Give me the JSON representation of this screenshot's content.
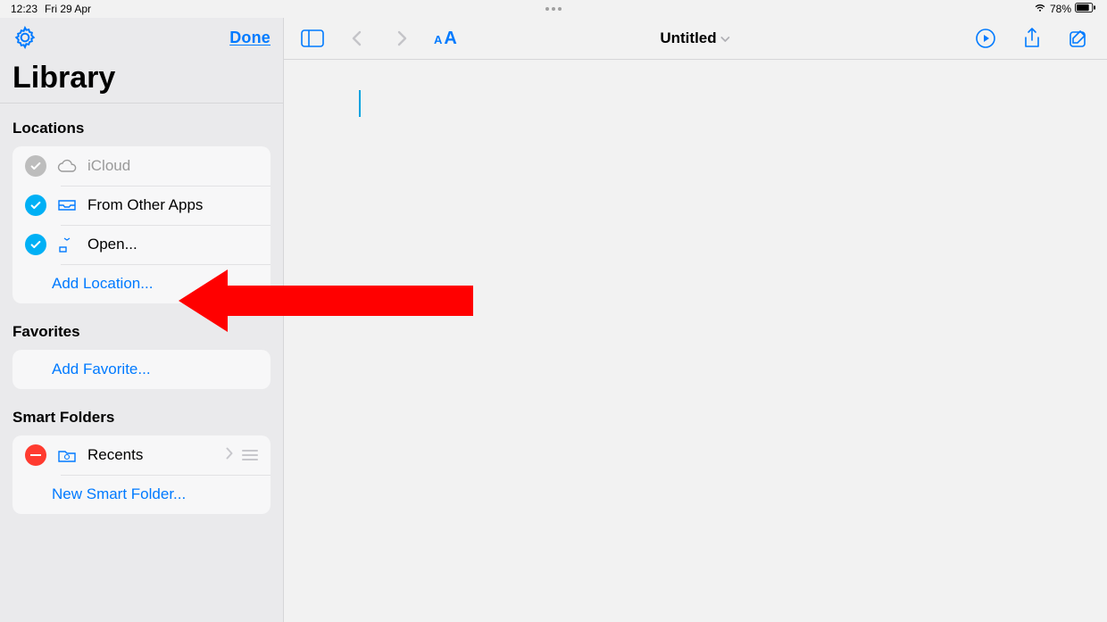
{
  "status": {
    "time": "12:23",
    "date": "Fri 29 Apr",
    "battery": "78%"
  },
  "sidebar": {
    "done": "Done",
    "title": "Library",
    "sections": {
      "locations": {
        "header": "Locations",
        "items": [
          {
            "label": "iCloud"
          },
          {
            "label": "From Other Apps"
          },
          {
            "label": "Open..."
          }
        ],
        "add": "Add Location..."
      },
      "favorites": {
        "header": "Favorites",
        "add": "Add Favorite..."
      },
      "smart": {
        "header": "Smart Folders",
        "items": [
          {
            "label": "Recents"
          }
        ],
        "add": "New Smart Folder..."
      }
    }
  },
  "main": {
    "title": "Untitled"
  }
}
